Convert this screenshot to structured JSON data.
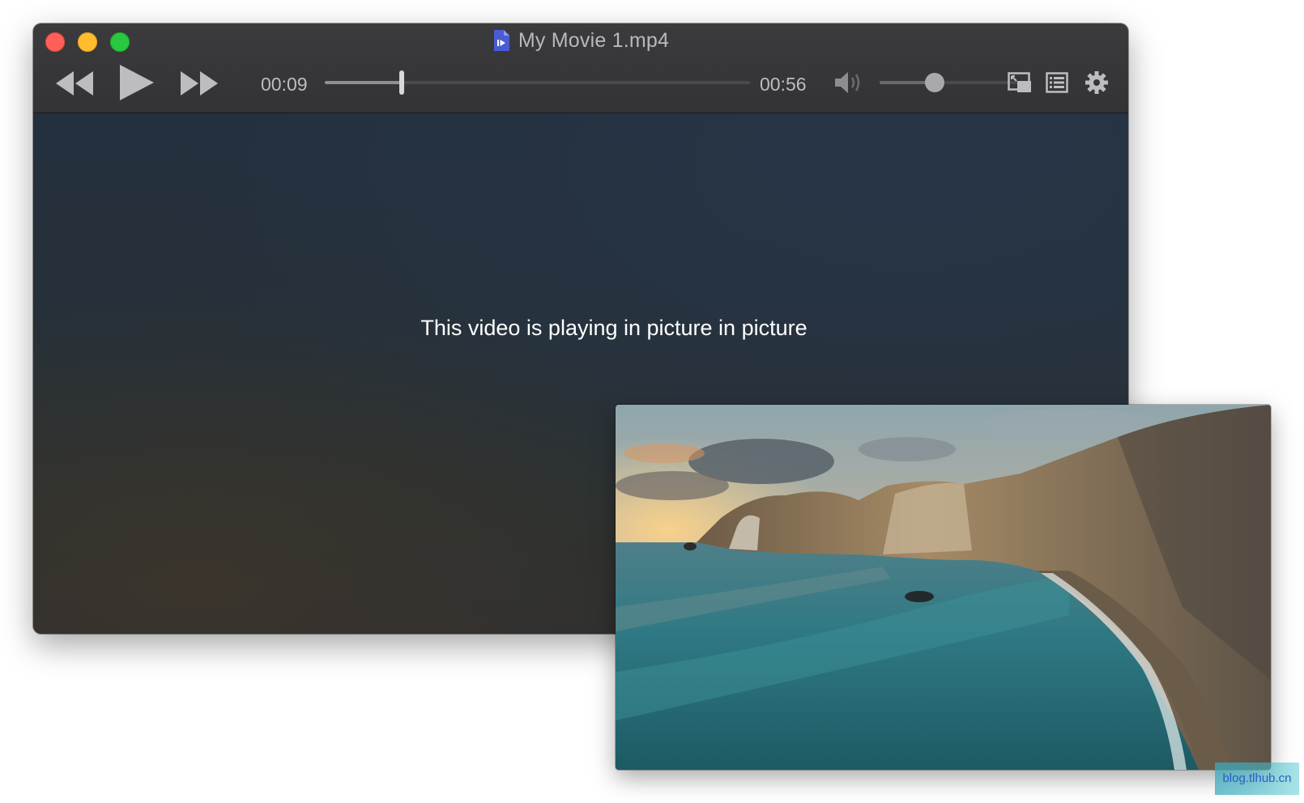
{
  "window": {
    "title": "My Movie 1.mp4"
  },
  "controls": {
    "current_time": "00:09",
    "total_time": "00:56",
    "progress_fraction": 0.18,
    "volume_fraction": 0.38,
    "icons": {
      "rewind": "rewind-icon",
      "play": "play-icon",
      "fast_forward": "fast-forward-icon",
      "volume": "volume-icon",
      "pip_toggle": "picture-in-picture-icon",
      "playlist": "playlist-icon",
      "settings": "gear-icon"
    }
  },
  "video": {
    "message": "This video is playing in picture in picture"
  },
  "watermark": {
    "text": "blog.tlhub.cn"
  },
  "colors": {
    "close": "#fe5f57",
    "minimize": "#febc2e",
    "maximize": "#28c840",
    "file_icon": "#4a5bd6"
  }
}
